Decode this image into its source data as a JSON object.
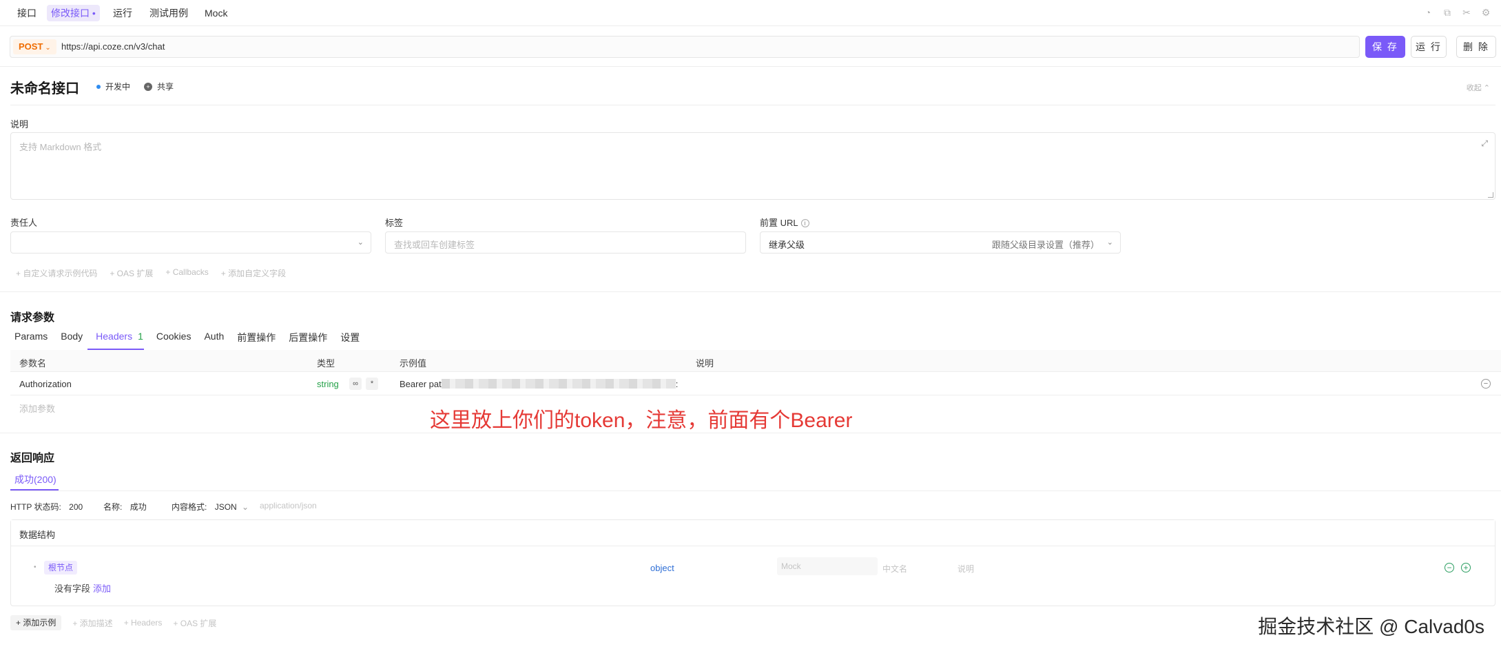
{
  "topnav": {
    "tabs": [
      "接口",
      "修改接口 •",
      "运行",
      "测试用例",
      "Mock"
    ],
    "active_index": 1
  },
  "request": {
    "method": "POST",
    "url": "https://api.coze.cn/v3/chat",
    "save_label": "保 存",
    "run_label": "运 行",
    "delete_label": "删 除"
  },
  "api": {
    "title": "未命名接口",
    "status": "开发中",
    "share": "共享",
    "collapse": "收起 ⌃"
  },
  "description": {
    "label": "说明",
    "placeholder": "支持 Markdown 格式"
  },
  "fields": {
    "owner_label": "责任人",
    "tags_label": "标签",
    "tags_placeholder": "查找或回车创建标签",
    "prefix_label": "前置 URL",
    "prefix_value": "继承父级",
    "prefix_hint": "跟随父级目录设置（推荐）"
  },
  "extras": [
    "+ 自定义请求示例代码",
    "+ OAS 扩展",
    "+ Callbacks",
    "+ 添加自定义字段"
  ],
  "params": {
    "section_title": "请求参数",
    "tabs": [
      "Params",
      "Body",
      "Headers",
      "Cookies",
      "Auth",
      "前置操作",
      "后置操作",
      "设置"
    ],
    "headers_count": "1",
    "columns": [
      "参数名",
      "类型",
      "示例值",
      "说明"
    ],
    "rows": [
      {
        "name": "Authorization",
        "type": "string",
        "example": "Bearer pat",
        "example_tail": ":"
      }
    ],
    "add_param": "添加参数"
  },
  "annotation": "这里放上你们的token，注意，前面有个Bearer",
  "response": {
    "section_title": "返回响应",
    "tab": "成功(200)",
    "status_label": "HTTP 状态码:",
    "status_value": "200",
    "name_label": "名称:",
    "name_value": "成功",
    "content_label": "内容格式:",
    "content_value": "JSON",
    "content_type": "application/json",
    "structure_title": "数据结构",
    "root_label": "根节点",
    "root_type": "object",
    "mock_placeholder": "Mock",
    "cn_name_placeholder": "中文名",
    "desc_placeholder": "说明",
    "no_field": "没有字段",
    "add_link": "添加"
  },
  "bottom_actions": [
    "+ 添加示例",
    "+ 添加描述",
    "+ Headers",
    "+ OAS 扩展"
  ],
  "watermark": "掘金技术社区 @ Calvad0s",
  "colors": {
    "accent": "#7a5af8",
    "method": "#ef6c00",
    "annotation": "#e53935",
    "string_type": "#24a148"
  }
}
